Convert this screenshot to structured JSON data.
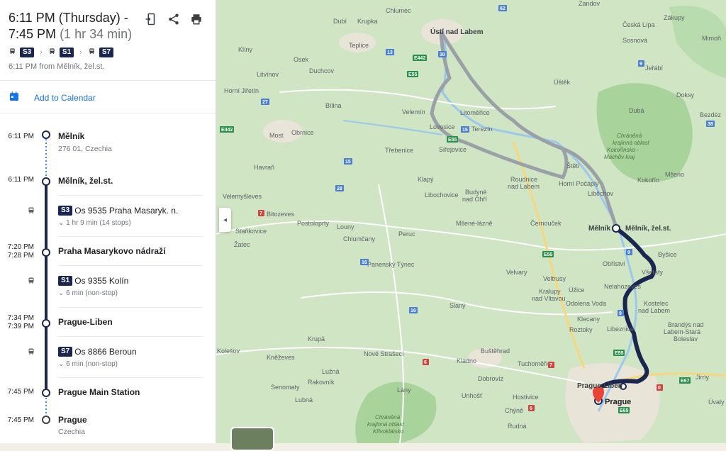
{
  "trip": {
    "depart_line": "6:11 PM (Thursday) -",
    "arrive_line": "7:45 PM",
    "duration": "(1 hr 34 min)",
    "lines": [
      "S3",
      "S1",
      "S7"
    ],
    "from_text": "6:11 PM from Mělník, žel.st.",
    "add_calendar": "Add to Calendar"
  },
  "icons": [
    "phone-send-icon",
    "share-icon",
    "print-icon",
    "calendar-icon",
    "train-icon"
  ],
  "steps": [
    {
      "time": "6:11 PM",
      "name": "Mělník",
      "detail": "276 01, Czechia"
    },
    {
      "time": "6:11 PM",
      "name": "Mělník, žel.st."
    },
    {
      "badge": "S3",
      "label": "Os 9535 Praha Masaryk. n.",
      "info": "1 hr 9 min (14 stops)"
    },
    {
      "time": "7:20 PM",
      "time2": "7:28 PM",
      "name": "Praha Masarykovo nádraží"
    },
    {
      "badge": "S1",
      "label": "Os 9355 Kolín",
      "info": "6 min (non-stop)"
    },
    {
      "time": "7:34 PM",
      "time2": "7:39 PM",
      "name": "Prague-Liben"
    },
    {
      "badge": "S7",
      "label": "Os 8866 Beroun",
      "info": "6 min (non-stop)"
    },
    {
      "time": "7:45 PM",
      "name": "Prague Main Station"
    },
    {
      "time": "7:45 PM",
      "name": "Prague",
      "detail": "Czechia"
    }
  ],
  "map": {
    "places": [
      "Zandov",
      "Chlumec",
      "Zákupy",
      "Krupka",
      "Dubí",
      "Česká Lípa",
      "Ústí nad Labem",
      "Mimoň",
      "Teplice",
      "Sosnová",
      "Klíny",
      "Osek",
      "Duchcov",
      "Jeřábí",
      "Litvínov",
      "Úštěk",
      "Doksy",
      "Horní Jiřetín",
      "Bílina",
      "Velemín",
      "Dubá",
      "Litoměřice",
      "Bezdéz",
      "Most",
      "Obrnice",
      "Lovosice",
      "Terezín",
      "Třebenice",
      "Siřejovice",
      "Chráněná krajinná oblast Kokořínsko - Máchův kraj",
      "Havraň",
      "Štětí",
      "Mšeno",
      "Klapý",
      "Roudnice nad Labem",
      "Horní Počáply",
      "Kokořín",
      "Libochovice",
      "Liběchov",
      "Velemyšleves",
      "Budyně nad Ohří",
      "Bitozeves",
      "Postoloprty",
      "Louny",
      "Mělník",
      "Mělník, žel.st.",
      "Černouček",
      "Staňkovice",
      "Peruc",
      "Mšené-lázně",
      "Žatec",
      "Chlumčany",
      "Byšice",
      "Obříství",
      "Panenský Týnec",
      "Velvary",
      "Veltrusy",
      "Všetaty",
      "Kralupy nad Vltavou",
      "Nelahozeves",
      "Úžice",
      "Odolena Voda",
      "Kostelec nad Labem",
      "Slaný",
      "Klecany",
      "Brandýs nad Labem-Stará Boleslav",
      "Libeznice",
      "Roztoky",
      "Krupá",
      "Buštěhrad",
      "Kolešov",
      "Nové Strašecí",
      "Kladno",
      "Kněževes",
      "Tuchoměřice",
      "Jirny",
      "Lužná",
      "Dobrovíz",
      "Prague-Liben",
      "Senomaty",
      "Rakovník",
      "Lány",
      "Unhošť",
      "Hostivice",
      "Prague",
      "Lubná",
      "Chýně",
      "Úvaly",
      "Chráněná krajinná oblast Křivoklátsko",
      "Rudná"
    ],
    "road_labels": [
      "62",
      "E442",
      "E55",
      "30",
      "13",
      "27",
      "E442",
      "15",
      "15",
      "E55",
      "28",
      "7",
      "16",
      "E55",
      "9",
      "16",
      "9",
      "E55",
      "6",
      "E65",
      "E67",
      "0",
      "7",
      "6",
      "9",
      "38"
    ]
  }
}
